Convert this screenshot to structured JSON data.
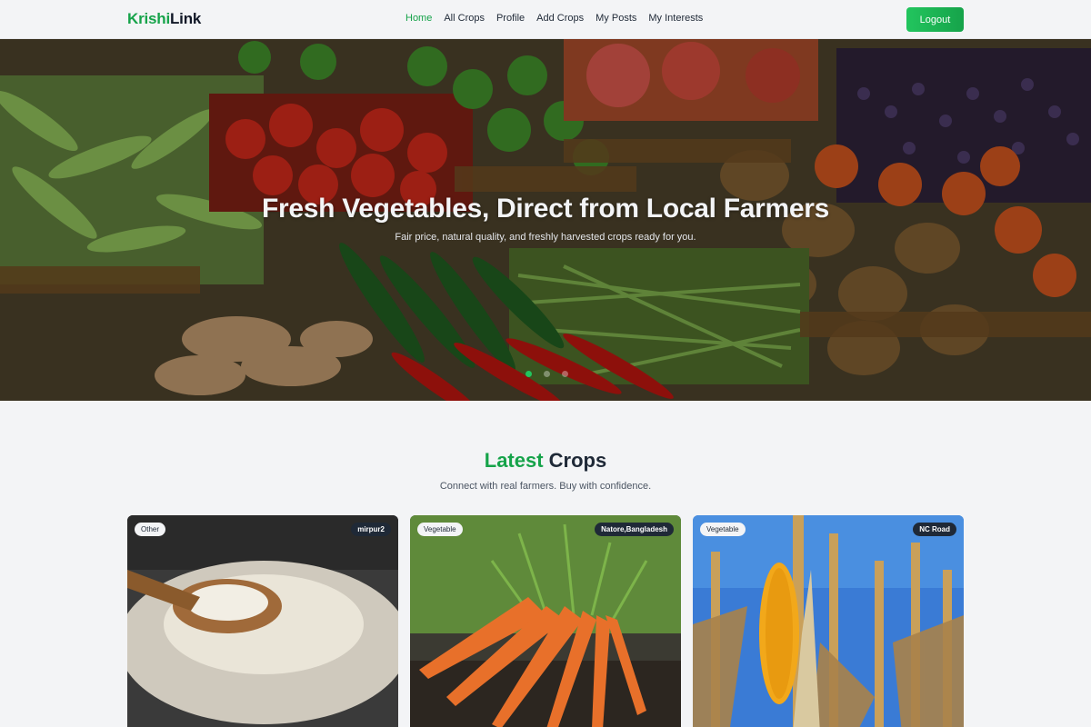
{
  "brand": {
    "part1": "Krishi",
    "part2": "Link"
  },
  "nav": {
    "links": [
      {
        "label": "Home",
        "active": true
      },
      {
        "label": "All Crops",
        "active": false
      },
      {
        "label": "Profile",
        "active": false
      },
      {
        "label": "Add Crops",
        "active": false
      },
      {
        "label": "My Posts",
        "active": false
      },
      {
        "label": "My Interests",
        "active": false
      }
    ],
    "logout_label": "Logout"
  },
  "hero": {
    "title": "Fresh Vegetables, Direct from Local Farmers",
    "subtitle": "Fair price, natural quality, and freshly harvested crops ready for you.",
    "slide_count": 3,
    "active_slide": 1
  },
  "section": {
    "title_highlight": "Latest",
    "title_rest": "Crops",
    "subtitle": "Connect with real farmers. Buy with confidence."
  },
  "cards": [
    {
      "category": "Other",
      "location": "mirpur2",
      "image": "rice-image"
    },
    {
      "category": "Vegetable",
      "location": "Natore,Bangladesh",
      "image": "carrots-image"
    },
    {
      "category": "Vegetable",
      "location": "NC Road",
      "image": "corn-image"
    }
  ],
  "colors": {
    "accent": "#16a34a",
    "button": "#22c55e",
    "dark": "#1f2937"
  }
}
